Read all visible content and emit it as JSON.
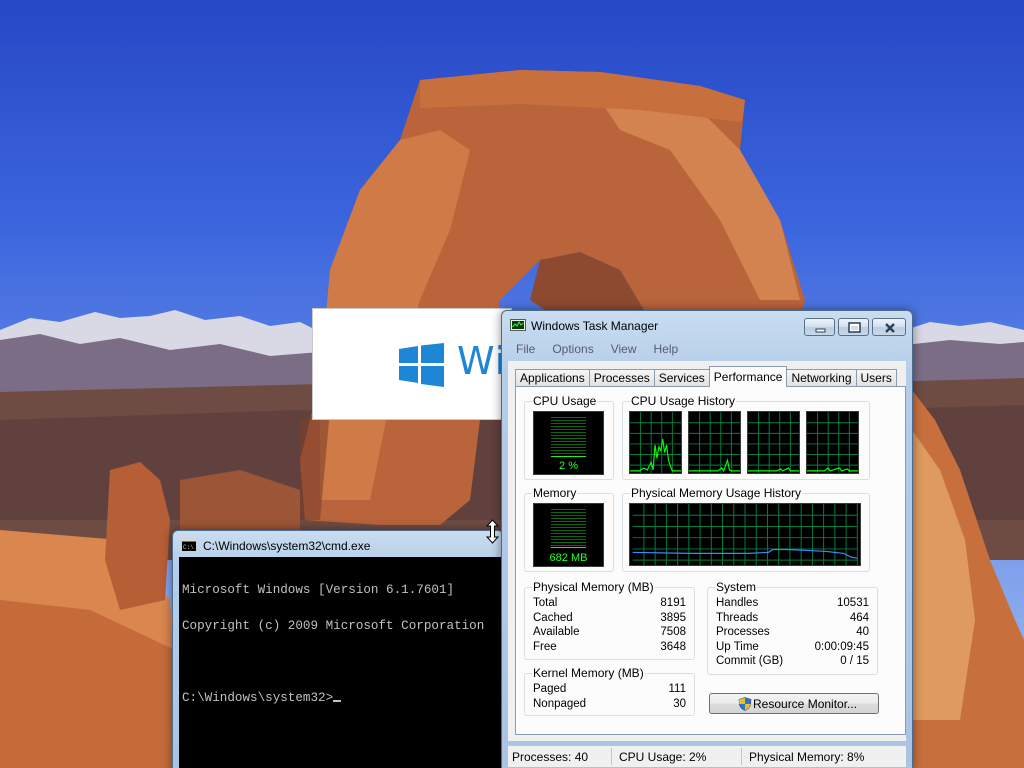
{
  "splash": {
    "text": "Wi"
  },
  "cmd": {
    "title": "C:\\Windows\\system32\\cmd.exe",
    "lines": [
      "Microsoft Windows [Version 6.1.7601]",
      "Copyright (c) 2009 Microsoft Corporation",
      "",
      "C:\\Windows\\system32>"
    ]
  },
  "task_manager": {
    "title": "Windows Task Manager",
    "window_buttons": {
      "minimize": "minimize",
      "maximize": "maximize",
      "close": "close"
    },
    "menu": [
      "File",
      "Options",
      "View",
      "Help"
    ],
    "tabs": [
      "Applications",
      "Processes",
      "Services",
      "Performance",
      "Networking",
      "Users"
    ],
    "active_tab": "Performance",
    "cpu_usage": {
      "label": "CPU Usage",
      "value_text": "2 %",
      "level": 0.02
    },
    "cpu_history": {
      "label": "CPU Usage History"
    },
    "memory": {
      "label": "Memory",
      "value_text": "682 MB",
      "level": 0.08
    },
    "memory_history": {
      "label": "Physical Memory Usage History"
    },
    "physical_memory": {
      "label": "Physical Memory (MB)",
      "rows": [
        {
          "key": "Total",
          "value": "8191"
        },
        {
          "key": "Cached",
          "value": "3895"
        },
        {
          "key": "Available",
          "value": "7508"
        },
        {
          "key": "Free",
          "value": "3648"
        }
      ]
    },
    "system": {
      "label": "System",
      "rows": [
        {
          "key": "Handles",
          "value": "10531"
        },
        {
          "key": "Threads",
          "value": "464"
        },
        {
          "key": "Processes",
          "value": "40"
        },
        {
          "key": "Up Time",
          "value": "0:00:09:45"
        },
        {
          "key": "Commit (GB)",
          "value": "0 / 15"
        }
      ]
    },
    "kernel_memory": {
      "label": "Kernel Memory (MB)",
      "rows": [
        {
          "key": "Paged",
          "value": "111"
        },
        {
          "key": "Nonpaged",
          "value": "30"
        }
      ]
    },
    "resource_monitor_button": "Resource Monitor...",
    "status_bar": {
      "processes": "Processes: 40",
      "cpu": "CPU Usage: 2%",
      "memory": "Physical Memory: 8%"
    },
    "graph_colors": {
      "grid": "#008040",
      "cpu_line": "#00ff00",
      "mem_line": "#3a8cff"
    }
  }
}
